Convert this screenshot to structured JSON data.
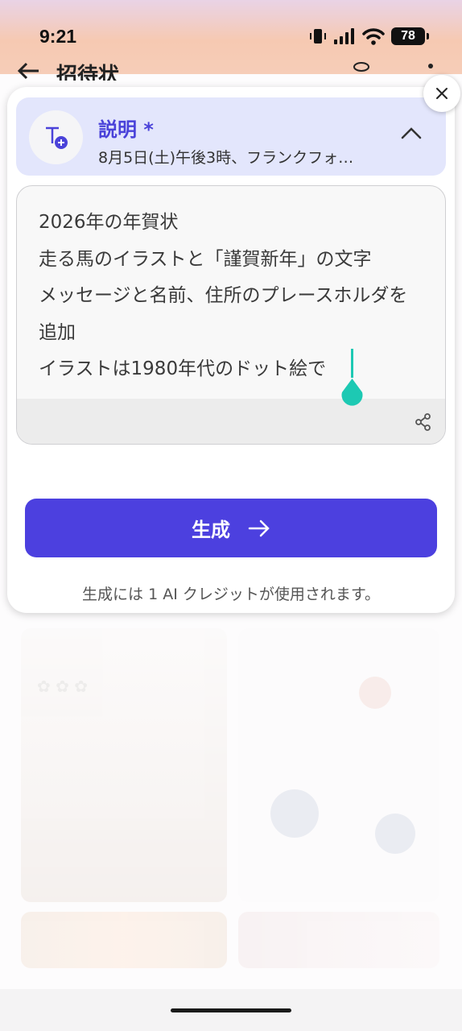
{
  "status_bar": {
    "time": "9:21",
    "battery": "78",
    "icons": [
      "vibrate-icon",
      "signal-icon",
      "wifi-icon",
      "battery-icon"
    ]
  },
  "app_header": {
    "title": "招待状",
    "icons": [
      "back-arrow-icon",
      "database-icon",
      "more-vertical-icon"
    ]
  },
  "sheet": {
    "section": {
      "title": "説明 *",
      "summary": "8月5日(土)午後3時、フランクフォ…",
      "icon": "text-add-icon"
    },
    "prompt": {
      "value": "2026年の年賀状\n走る馬のイラストと「謹賀新年」の文字\nメッセージと名前、住所のプレースホルダを追加\nイラストは1980年代のドット絵で",
      "share_icon": "share-icon"
    },
    "generate_label": "生成",
    "credit_note": "生成には 1 AI クレジットが使用されます。"
  },
  "colors": {
    "accent": "#4c40df",
    "section_bg": "#e3e6fc",
    "cursor": "#1dc9b3"
  }
}
